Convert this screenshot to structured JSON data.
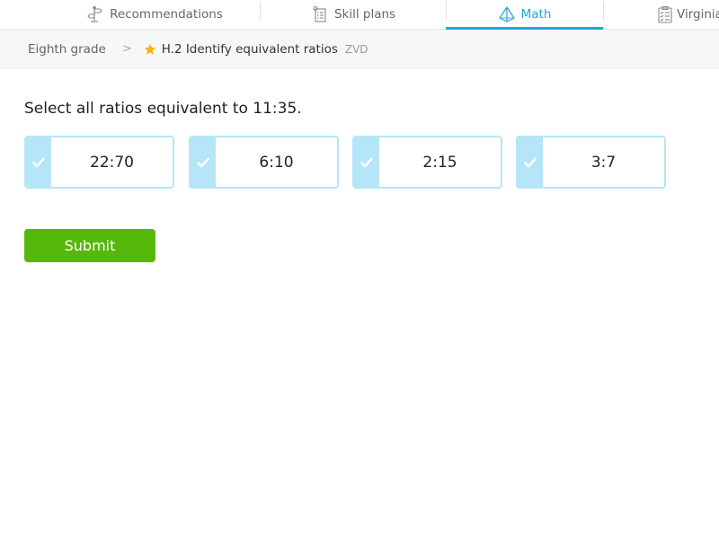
{
  "nav": {
    "tabs": [
      {
        "label": "Recommendations",
        "icon": "signpost-icon",
        "active": false
      },
      {
        "label": "Skill plans",
        "icon": "clipboard-list-icon",
        "active": false
      },
      {
        "label": "Math",
        "icon": "pyramid-icon",
        "active": true
      },
      {
        "label": "Virginia",
        "icon": "checklist-icon",
        "active": false
      }
    ]
  },
  "breadcrumb": {
    "grade": "Eighth grade",
    "separator": ">",
    "skill": "H.2 Identify equivalent ratios",
    "code": "ZVD"
  },
  "question": {
    "prompt": "Select all ratios equivalent to 11:35.",
    "choices": [
      {
        "label": "22:70",
        "selected": false
      },
      {
        "label": "6:10",
        "selected": false
      },
      {
        "label": "2:15",
        "selected": false
      },
      {
        "label": "3:7",
        "selected": false
      }
    ]
  },
  "submit": {
    "label": "Submit"
  },
  "colors": {
    "accent": "#1ca6d9",
    "choice_border": "#b5e6f7",
    "submit": "#56b80c",
    "star": "#f6b21b"
  }
}
